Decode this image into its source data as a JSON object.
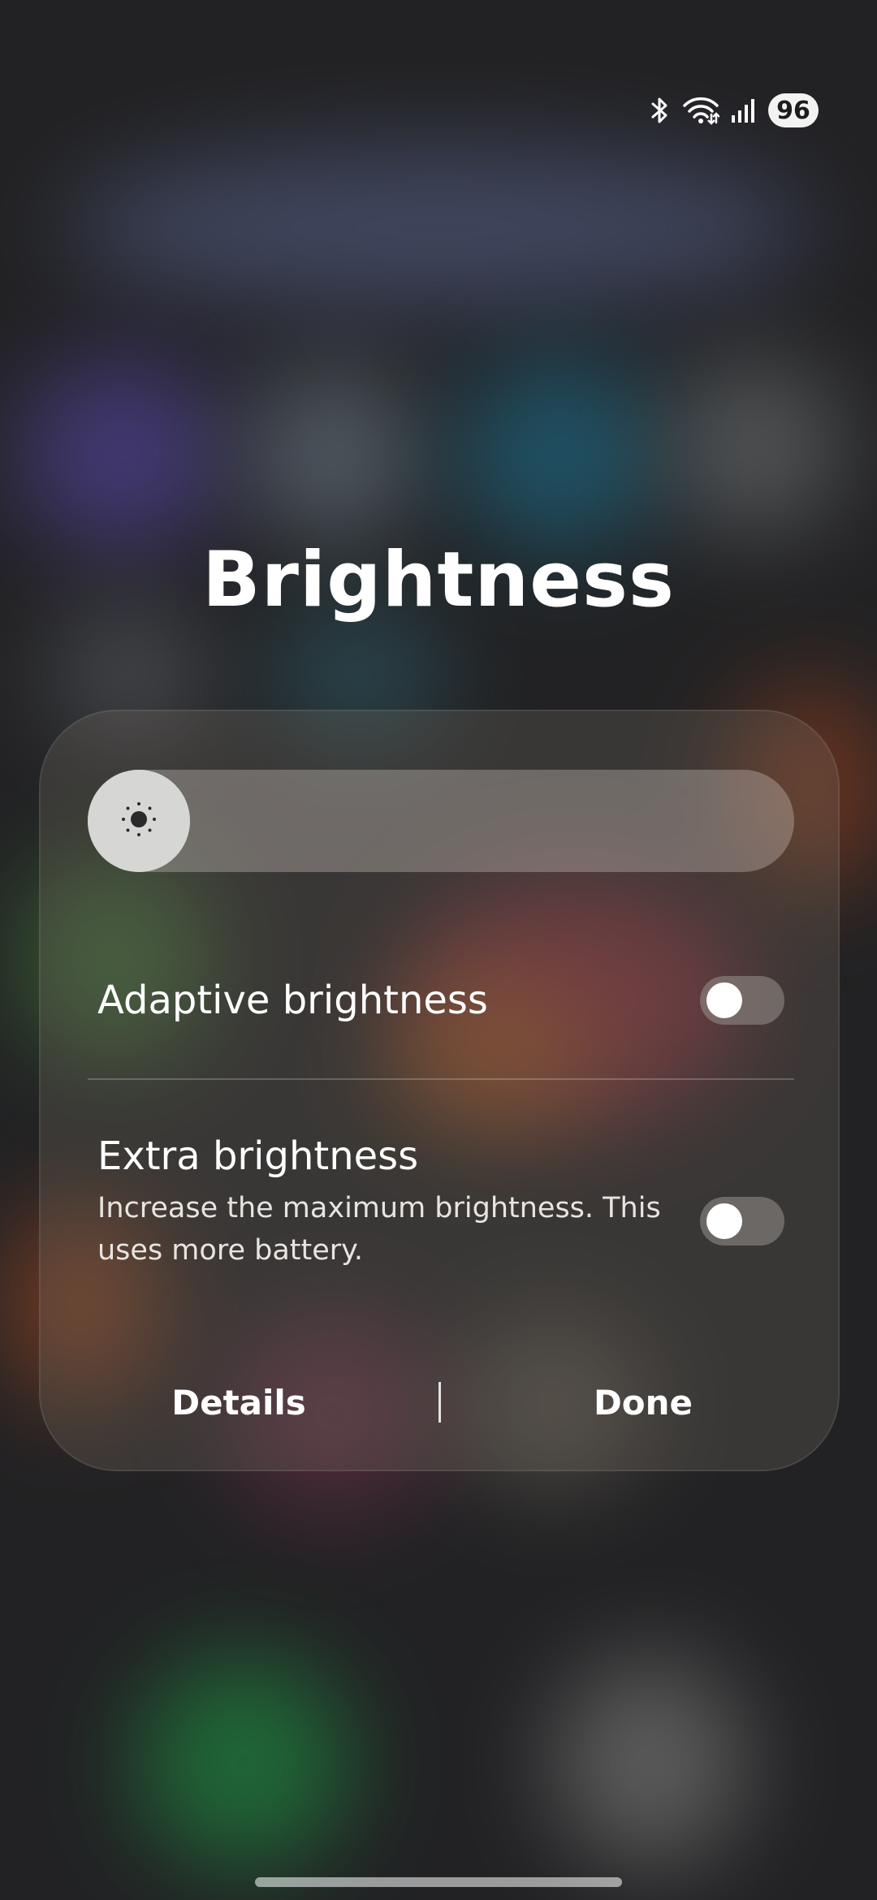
{
  "status_bar": {
    "icons": [
      "bluetooth-icon",
      "wifi-icon",
      "cellular-signal-icon"
    ],
    "battery_level": "96"
  },
  "title": "Brightness",
  "slider": {
    "icon": "sun-icon",
    "level": 0.0
  },
  "settings": {
    "adaptive": {
      "label": "Adaptive brightness",
      "enabled": false
    },
    "extra": {
      "label": "Extra brightness",
      "description": "Increase the maximum brightness. This uses more battery.",
      "enabled": false
    }
  },
  "footer": {
    "details_label": "Details",
    "done_label": "Done"
  },
  "colors": {
    "text": "#ffffff",
    "toggle_off_track": "#8f8b87",
    "toggle_knob": "#ffffff",
    "battery_badge": "#f2f2f2"
  }
}
